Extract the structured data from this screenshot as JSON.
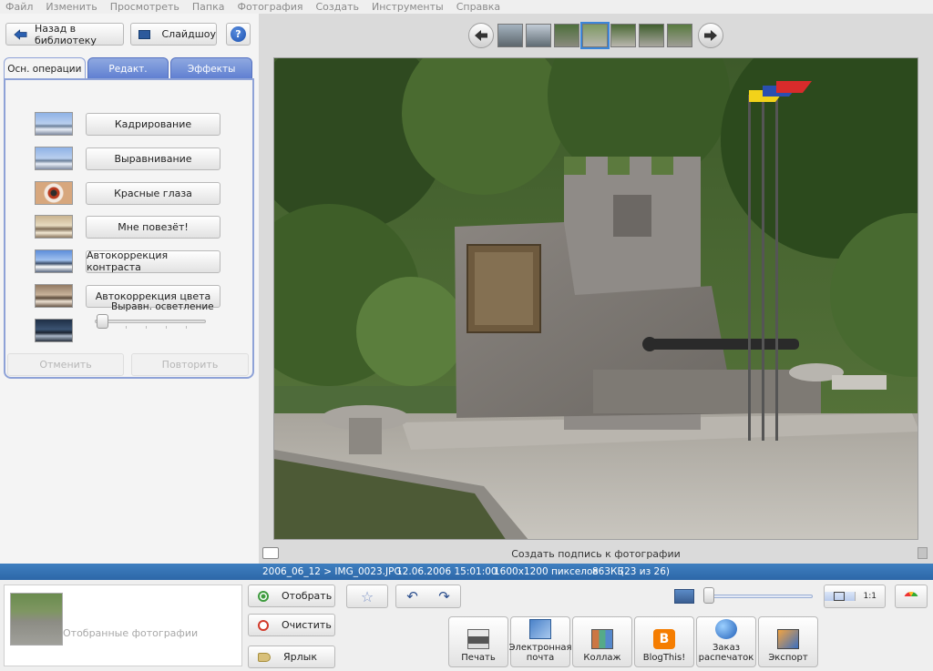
{
  "menu": [
    "Файл",
    "Изменить",
    "Просмотреть",
    "Папка",
    "Фотография",
    "Создать",
    "Инструменты",
    "Справка"
  ],
  "toolbar": {
    "back_label": "Назад в библиотеку",
    "slideshow_label": "Слайдшоу",
    "help_label": "?"
  },
  "tabs": [
    {
      "label": "Осн. операции",
      "active": true
    },
    {
      "label": "Редакт.",
      "active": false
    },
    {
      "label": "Эффекты",
      "active": false
    }
  ],
  "operations": [
    {
      "label": "Кадрирование",
      "icon": "crop-icon"
    },
    {
      "label": "Выравнивание",
      "icon": "straighten-icon"
    },
    {
      "label": "Красные глаза",
      "icon": "red-eye-icon"
    },
    {
      "label": "Мне повезёт!",
      "icon": "lucky-icon"
    },
    {
      "label": "Автокоррекция контраста",
      "icon": "auto-contrast-icon"
    },
    {
      "label": "Автокоррекция цвета",
      "icon": "auto-color-icon"
    }
  ],
  "fill_light": {
    "label": "Выравн. осветление",
    "value": 0
  },
  "history": {
    "undo_label": "Отменить",
    "redo_label": "Повторить"
  },
  "viewer": {
    "caption_placeholder": "Создать подпись к фотографии",
    "filmstrip_selected_index": 3
  },
  "photo_info": {
    "path": "2006_06_12 > IMG_0023.JPG",
    "date": "12.06.2006 15:01:00",
    "dimensions": "1600x1200 пикселов",
    "size": "863КБ",
    "position": "(23 из 26)"
  },
  "tray": {
    "label": "Отобранные фотографии"
  },
  "tray_buttons": {
    "hold_label": "Отобрать",
    "clear_label": "Очистить",
    "label_label": "Ярлык"
  },
  "zoom": {
    "fit_label": "",
    "actual_label": "1:1",
    "level": 0
  },
  "actions": [
    {
      "label": "Печать",
      "icon": "print-icon"
    },
    {
      "label": "Электронная почта",
      "icon": "email-icon"
    },
    {
      "label": "Коллаж",
      "icon": "collage-icon"
    },
    {
      "label": "BlogThis!",
      "icon": "blogger-icon"
    },
    {
      "label": "Заказ распечаток",
      "icon": "order-prints-icon"
    },
    {
      "label": "Экспорт",
      "icon": "export-icon"
    }
  ],
  "colors": {
    "accent": "#2d67a8",
    "tab_active_border": "#8ea2d7",
    "tab_inactive": "#5e7ed1"
  }
}
